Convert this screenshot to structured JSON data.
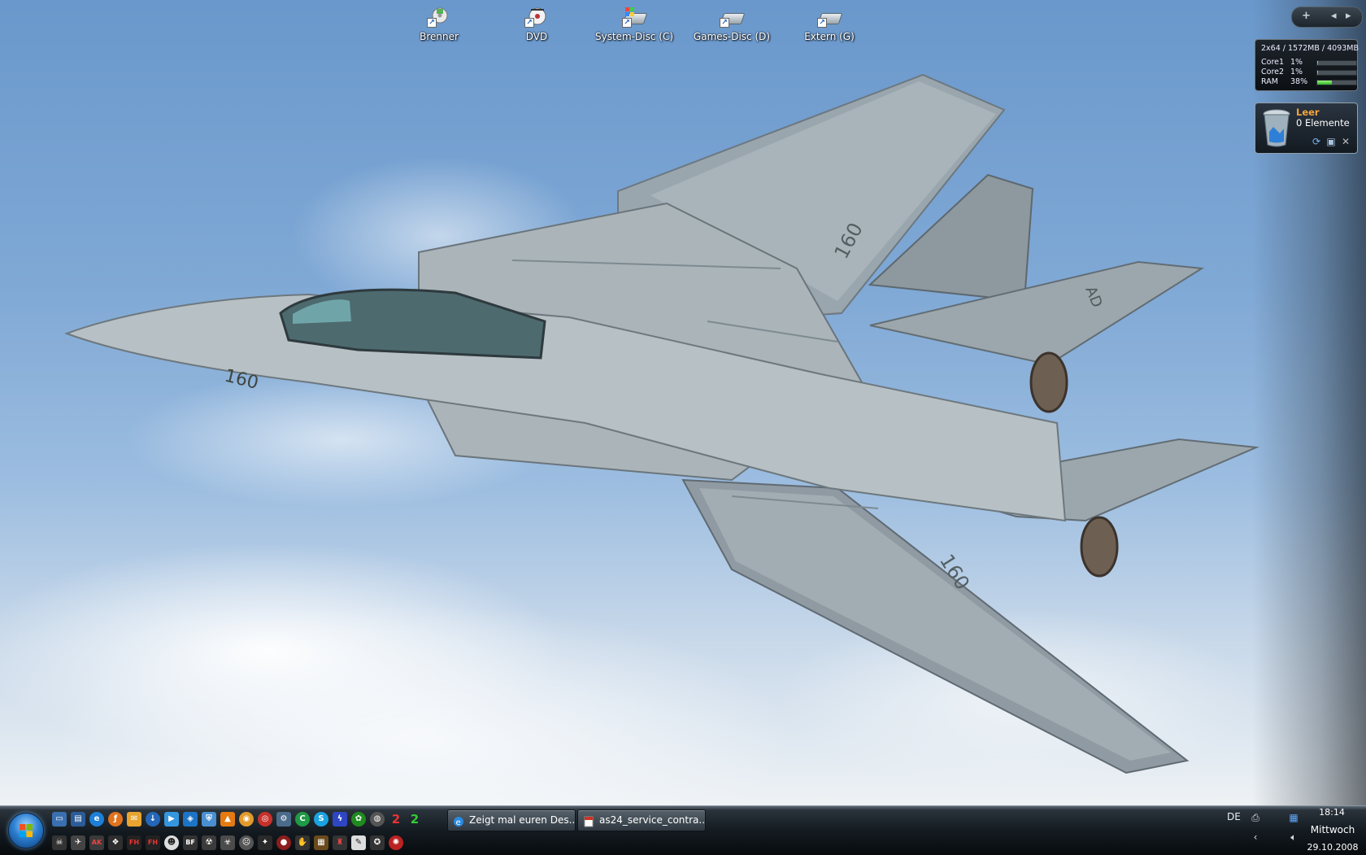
{
  "desktop_icons": [
    {
      "label": "Brenner",
      "icon": "burner-icon"
    },
    {
      "label": "DVD",
      "icon": "dvd-icon"
    },
    {
      "label": "System-Disc (C)",
      "icon": "drive-icon"
    },
    {
      "label": "Games-Disc (D)",
      "icon": "drive-icon"
    },
    {
      "label": "Extern (G)",
      "icon": "drive-icon"
    }
  ],
  "wallpaper": {
    "tail_marking_top": "160",
    "nose_marking": "160",
    "tail_marking_bottom": "160",
    "fin_code": "AD"
  },
  "sidebar": {
    "controls": {
      "add": "+",
      "prev": "◂",
      "next": "▸"
    },
    "cpu_meter": {
      "header": "2x64 / 1572MB / 4093MB",
      "rows": [
        {
          "name": "Core1",
          "percent": "1%",
          "level": 0.01
        },
        {
          "name": "Core2",
          "percent": "1%",
          "level": 0.01
        },
        {
          "name": "RAM",
          "percent": "38%",
          "level": 0.38
        }
      ]
    },
    "recycle_bin": {
      "status": "Leer",
      "count": "0 Elemente"
    }
  },
  "taskbar": {
    "tasks": [
      {
        "label": "Zeigt mal euren Des...",
        "icon": "ie-icon"
      },
      {
        "label": "as24_service_contra...",
        "icon": "pdf-icon"
      }
    ],
    "language": "DE",
    "clock": {
      "time": "18:14",
      "day": "Mittwoch",
      "date": "29.10.2008"
    }
  },
  "colors": {
    "accent": "#2c7fd1",
    "bin_status": "#f3a33a",
    "ram_fill": "#2bb32b"
  }
}
